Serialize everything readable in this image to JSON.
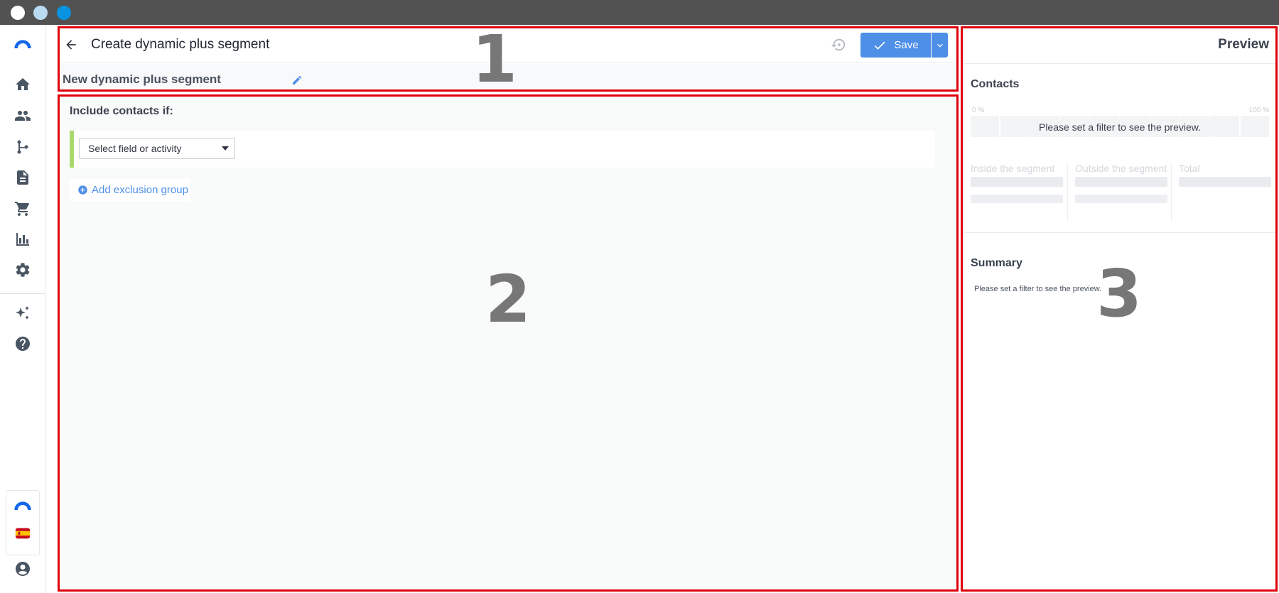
{
  "window": {
    "controls": [
      "close",
      "minimize",
      "maximize"
    ]
  },
  "sidebar": {
    "items": [
      {
        "icon": "home-icon"
      },
      {
        "icon": "contacts-icon"
      },
      {
        "icon": "automation-icon"
      },
      {
        "icon": "document-icon"
      },
      {
        "icon": "cart-icon"
      },
      {
        "icon": "reports-icon"
      },
      {
        "icon": "settings-icon"
      },
      {
        "icon": "sparkle-icon"
      },
      {
        "icon": "help-icon"
      }
    ],
    "bottom": [
      {
        "icon": "brand-logo"
      },
      {
        "icon": "spain-flag-icon"
      },
      {
        "icon": "account-icon"
      }
    ]
  },
  "header": {
    "title": "Create dynamic plus segment",
    "save_label": "Save"
  },
  "segment": {
    "name": "New dynamic plus segment"
  },
  "builder": {
    "include_label": "Include contacts if:",
    "field_select_value": "Select field or activity",
    "add_exclusion_label": "Add exclusion group"
  },
  "preview": {
    "title": "Preview",
    "contacts_title": "Contacts",
    "pct_min": "0 %",
    "pct_max": "100 %",
    "empty_message": "Please set a filter to see the preview.",
    "stats": [
      {
        "label": "Inside the segment"
      },
      {
        "label": "Outside the segment"
      },
      {
        "label": "Total"
      }
    ],
    "summary_title": "Summary",
    "summary_message": "Please set a filter to see the preview."
  },
  "annotations": [
    "1",
    "2",
    "3"
  ],
  "colors": {
    "accent": "#4e8fe8",
    "highlight_box": "#e0000a",
    "rule_group_bar": "#a9d96c",
    "titlebar": "#525252"
  }
}
